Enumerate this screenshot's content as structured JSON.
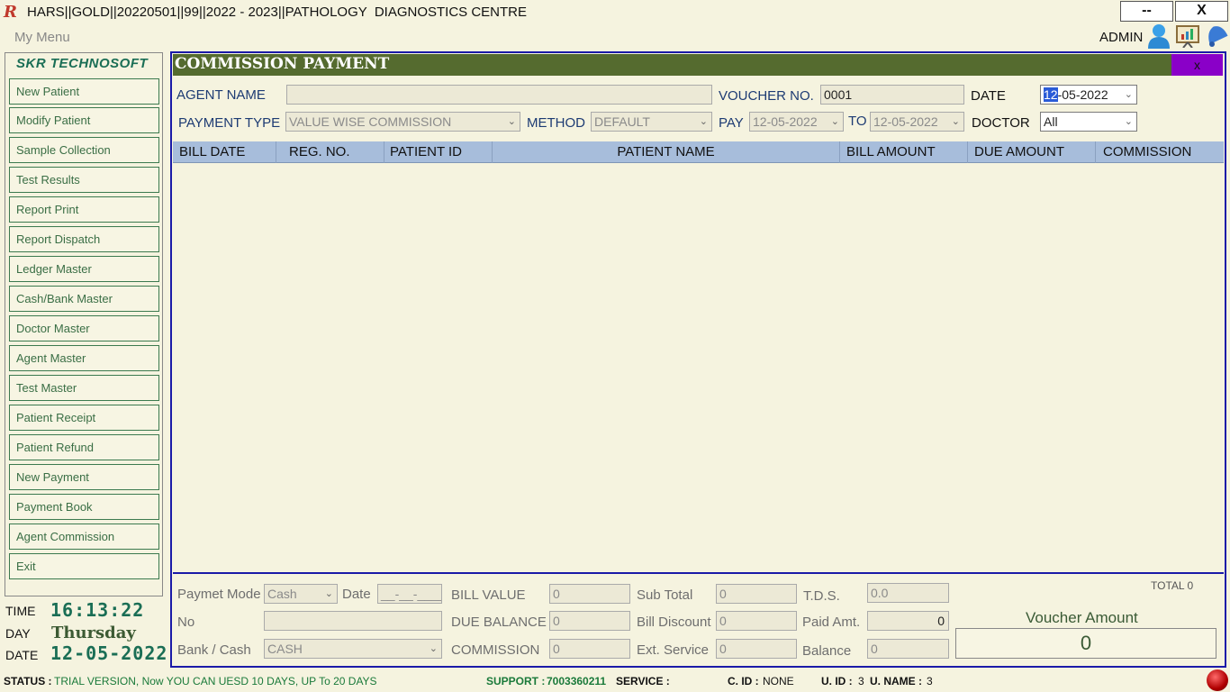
{
  "window": {
    "title": "HARS||GOLD||20220501||99||2022 - 2023||PATHOLOGY  DIAGNOSTICS CENTRE",
    "minimize_label": "--",
    "close_label": "X"
  },
  "menubar": {
    "label": "My Menu",
    "user": "ADMIN"
  },
  "sidebar": {
    "brand": "SKR TECHNOSOFT",
    "items": [
      {
        "label": "New Patient"
      },
      {
        "label": "Modify Patient"
      },
      {
        "label": "Sample Collection"
      },
      {
        "label": "Test Results"
      },
      {
        "label": "Report Print"
      },
      {
        "label": "Report Dispatch"
      },
      {
        "label": "Ledger Master"
      },
      {
        "label": "Cash/Bank Master"
      },
      {
        "label": "Doctor Master"
      },
      {
        "label": "Agent Master"
      },
      {
        "label": "Test Master"
      },
      {
        "label": "Patient Receipt"
      },
      {
        "label": "Patient Refund"
      },
      {
        "label": "New Payment"
      },
      {
        "label": "Payment Book"
      },
      {
        "label": "Agent Commission"
      },
      {
        "label": "Exit"
      }
    ],
    "clock": {
      "time_label": "TIME",
      "time": "16:13:22",
      "day_label": "DAY",
      "day": "Thursday",
      "date_label": "DATE",
      "date": "12-05-2022"
    }
  },
  "form": {
    "title": "COMMISSION PAYMENT",
    "close_label": "x",
    "agent_name_label": "AGENT NAME",
    "agent_name_value": "",
    "voucher_label": "VOUCHER NO.",
    "voucher_value": "0001",
    "date_label": "DATE",
    "date_sel": "12",
    "date_rest": "-05-2022",
    "payment_type_label": "PAYMENT TYPE",
    "payment_type_value": "VALUE WISE COMMISSION",
    "method_label": "METHOD",
    "method_value": "DEFAULT",
    "pay_label": "PAY",
    "pay_from": "12-05-2022",
    "to_label": "TO",
    "pay_to": "12-05-2022",
    "doctor_label": "DOCTOR",
    "doctor_value": "All"
  },
  "grid": {
    "columns": [
      "BILL DATE",
      "REG. NO.",
      "PATIENT ID",
      "PATIENT NAME",
      "BILL AMOUNT",
      "DUE AMOUNT",
      "COMMISSION"
    ],
    "rows": []
  },
  "footer": {
    "payment_mode_label": "Paymet Mode",
    "payment_mode_value": "Cash",
    "date_label": "Date",
    "date_value": "__-__-____",
    "no_label": "No",
    "no_value": "",
    "bank_cash_label": "Bank / Cash",
    "bank_cash_value": "CASH",
    "bill_value_label": "BILL VALUE",
    "bill_value": "0",
    "due_balance_label": "DUE BALANCE",
    "due_balance": "0",
    "commission_label": "COMMISSION",
    "commission": "0",
    "sub_total_label": "Sub Total",
    "sub_total": "0",
    "bill_discount_label": "Bill Discount",
    "bill_discount": "0",
    "ext_service_label": "Ext. Service",
    "ext_service": "0",
    "tds_label": "T.D.S.",
    "tds": "0.0",
    "paid_amt_label": "Paid Amt.",
    "paid_amt": "0",
    "balance_label": "Balance",
    "balance": "0",
    "total_text": "TOTAL 0",
    "voucher_amount_label": "Voucher Amount",
    "voucher_amount": "0"
  },
  "status": {
    "status_key": "STATUS :",
    "status_val": "TRIAL VERSION, Now YOU CAN UESD 10 DAYS, UP To 20 DAYS",
    "support_key": "SUPPORT :",
    "support_val": "7003360211",
    "service_key": "SERVICE :",
    "cid_key": "C. ID :",
    "cid_val": "NONE",
    "uid_key": "U. ID :",
    "uid_val": "3",
    "uname_key": "U. NAME :",
    "uname_val": "3"
  }
}
